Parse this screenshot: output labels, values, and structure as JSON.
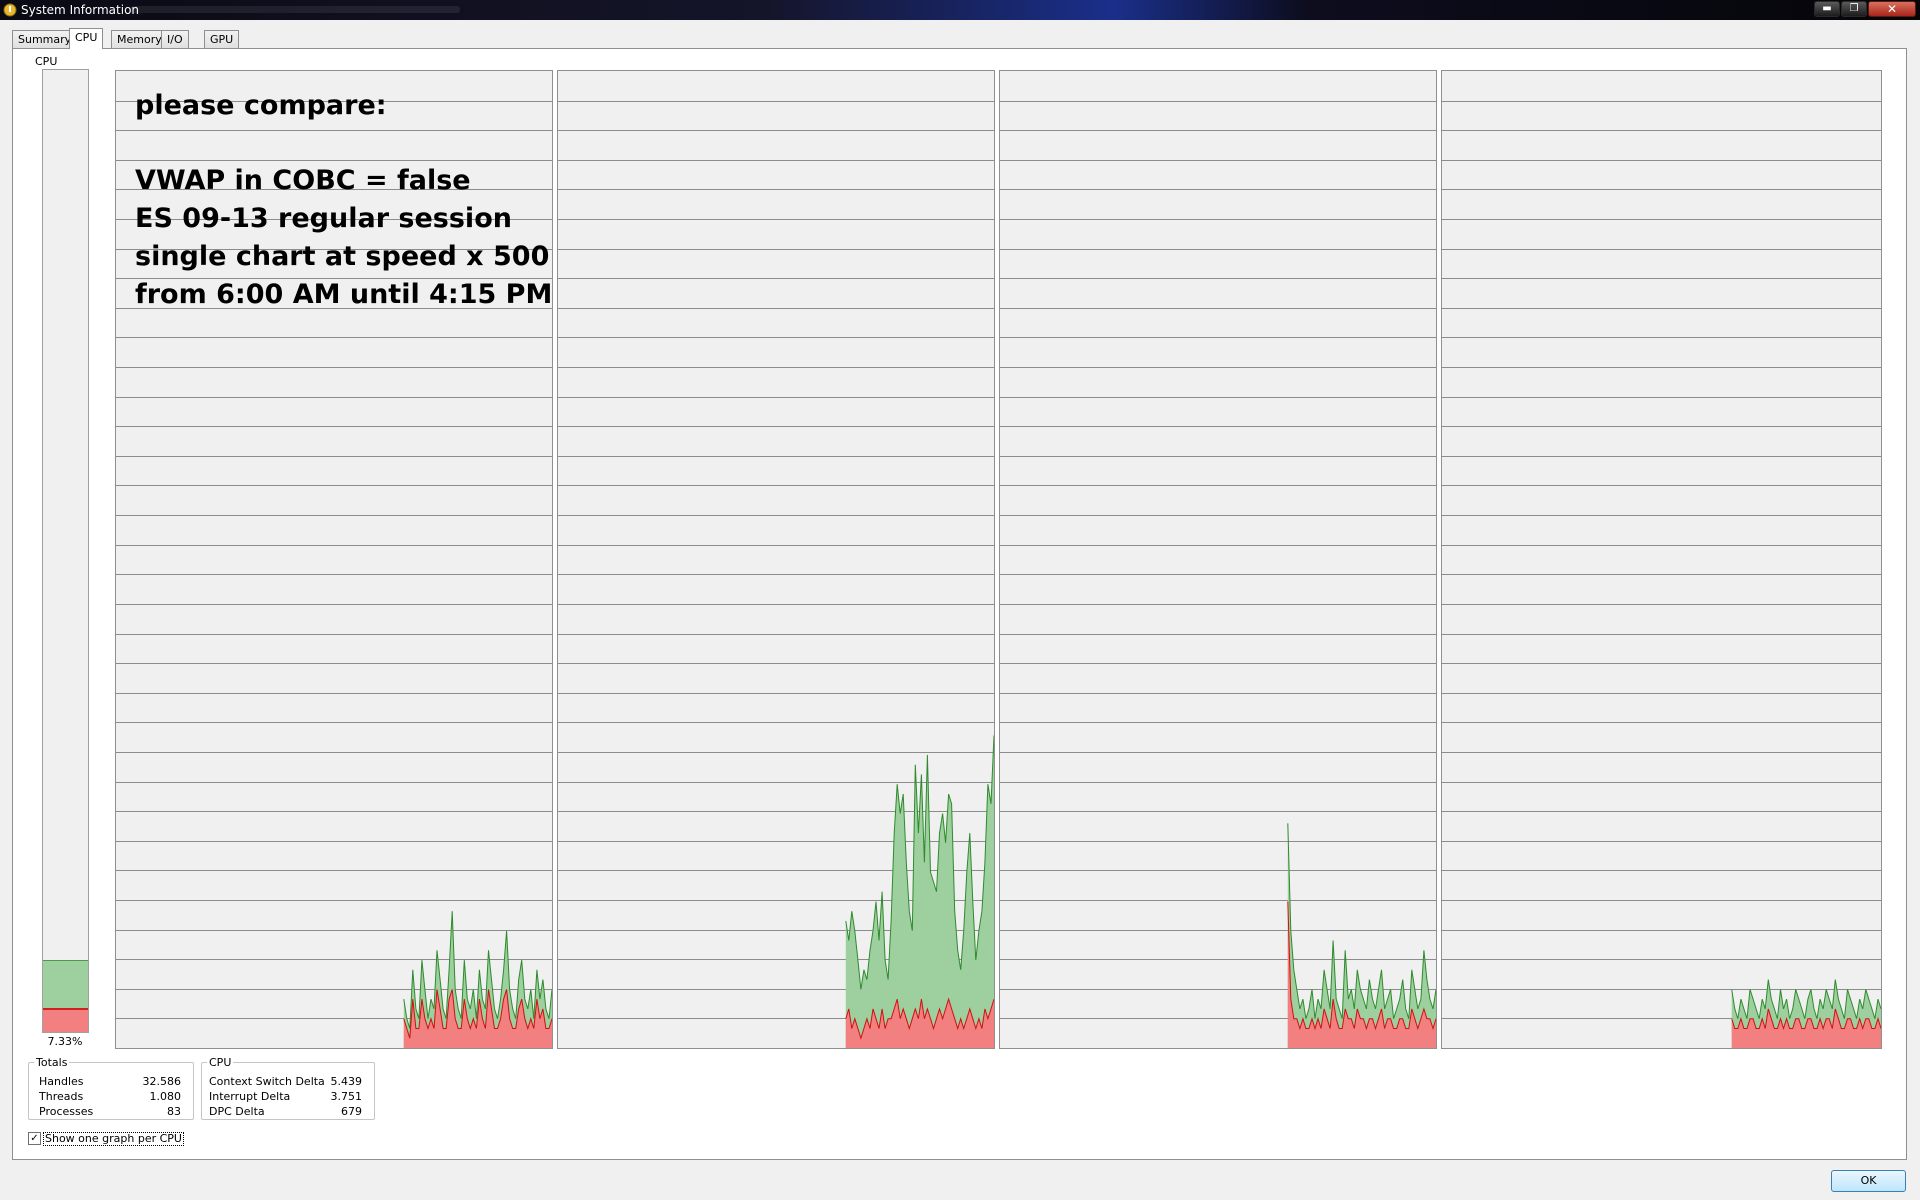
{
  "window": {
    "title": "System Information",
    "min_glyph": "▬",
    "max_glyph": "❐",
    "close_glyph": "✕"
  },
  "tabs": [
    {
      "label": "Summary",
      "active": false
    },
    {
      "label": "CPU",
      "active": true
    },
    {
      "label": "Memory",
      "active": false
    },
    {
      "label": "I/O",
      "active": false
    },
    {
      "label": "GPU",
      "active": false
    }
  ],
  "cpu_overview": {
    "label": "CPU",
    "percent_text": "7.33%",
    "total_fraction": 0.075,
    "kernel_fraction": 0.025
  },
  "annotation": {
    "line1": "please compare:",
    "line2": "VWAP in COBC = false",
    "line3": "ES 09-13 regular session",
    "line4": "single chart at speed x 500",
    "line5": "from 6:00 AM until 4:15 PM"
  },
  "totals": {
    "title": "Totals",
    "handles_label": "Handles",
    "handles_value": "32.586",
    "threads_label": "Threads",
    "threads_value": "1.080",
    "processes_label": "Processes",
    "processes_value": "83"
  },
  "cpu_stats": {
    "title": "CPU",
    "context_switch_label": "Context Switch Delta",
    "context_switch_value": "5.439",
    "interrupt_label": "Interrupt Delta",
    "interrupt_value": "3.751",
    "dpc_label": "DPC Delta",
    "dpc_value": "679"
  },
  "show_one_graph": {
    "label": "Show one graph per CPU",
    "checked": true,
    "check_glyph": "✓"
  },
  "ok_button": {
    "label": "OK"
  },
  "colors": {
    "total_line": "#2e8b2e",
    "total_fill": "#9ecf9e",
    "kernel_line": "#d01010",
    "kernel_fill": "#f28080",
    "grid": "#8c8c8c",
    "graph_bg": "#f0f0f0"
  },
  "chart_data": {
    "type": "area",
    "y_range": [
      0,
      100
    ],
    "series_per_cpu": [
      {
        "cpu": 1,
        "history_start": 0.66,
        "total_percent": [
          5,
          3,
          2,
          8,
          4,
          3,
          9,
          6,
          3,
          5,
          4,
          10,
          7,
          4,
          3,
          8,
          14,
          6,
          4,
          3,
          9,
          5,
          4,
          6,
          3,
          8,
          5,
          4,
          10,
          7,
          4,
          3,
          5,
          8,
          12,
          6,
          4,
          3,
          7,
          9,
          5,
          4,
          6,
          3,
          8,
          5,
          7,
          4,
          3,
          6
        ],
        "kernel_percent": [
          3,
          2,
          1,
          5,
          2,
          2,
          5,
          3,
          2,
          3,
          2,
          6,
          4,
          2,
          2,
          5,
          6,
          3,
          2,
          2,
          5,
          3,
          2,
          3,
          2,
          5,
          3,
          2,
          6,
          4,
          2,
          2,
          3,
          5,
          6,
          3,
          2,
          2,
          4,
          5,
          3,
          2,
          3,
          2,
          5,
          3,
          4,
          2,
          2,
          3
        ]
      },
      {
        "cpu": 2,
        "history_start": 0.66,
        "total_percent": [
          13,
          11,
          14,
          12,
          9,
          6,
          8,
          7,
          10,
          12,
          15,
          11,
          16,
          9,
          7,
          13,
          22,
          27,
          24,
          26,
          19,
          14,
          12,
          29,
          22,
          28,
          19,
          30,
          18,
          17,
          16,
          22,
          24,
          21,
          26,
          25,
          14,
          10,
          8,
          12,
          18,
          22,
          15,
          9,
          12,
          14,
          19,
          27,
          25,
          32
        ],
        "kernel_percent": [
          3,
          4,
          2,
          3,
          2,
          1,
          2,
          3,
          2,
          4,
          3,
          2,
          4,
          2,
          3,
          3,
          4,
          5,
          3,
          4,
          3,
          2,
          3,
          4,
          3,
          5,
          3,
          4,
          3,
          2,
          3,
          4,
          3,
          4,
          5,
          4,
          3,
          2,
          3,
          2,
          3,
          4,
          3,
          2,
          3,
          2,
          4,
          3,
          4,
          5
        ]
      },
      {
        "cpu": 3,
        "history_start": 0.66,
        "total_percent": [
          23,
          12,
          8,
          6,
          4,
          5,
          3,
          4,
          6,
          3,
          5,
          4,
          8,
          6,
          4,
          11,
          5,
          4,
          3,
          10,
          5,
          6,
          4,
          8,
          6,
          5,
          4,
          7,
          5,
          4,
          6,
          8,
          4,
          5,
          6,
          3,
          4,
          5,
          7,
          4,
          3,
          8,
          6,
          4,
          5,
          10,
          7,
          5,
          4,
          6
        ],
        "kernel_percent": [
          15,
          5,
          3,
          3,
          2,
          3,
          2,
          2,
          3,
          2,
          3,
          2,
          4,
          3,
          2,
          5,
          3,
          2,
          2,
          4,
          3,
          3,
          2,
          4,
          3,
          3,
          2,
          3,
          3,
          2,
          3,
          4,
          2,
          3,
          3,
          2,
          2,
          3,
          3,
          2,
          2,
          4,
          3,
          2,
          3,
          4,
          3,
          3,
          2,
          3
        ]
      },
      {
        "cpu": 4,
        "history_start": 0.66,
        "total_percent": [
          6,
          4,
          3,
          5,
          4,
          3,
          6,
          5,
          4,
          3,
          5,
          4,
          7,
          5,
          4,
          3,
          6,
          4,
          5,
          3,
          4,
          6,
          5,
          4,
          3,
          5,
          6,
          4,
          3,
          5,
          4,
          6,
          5,
          4,
          7,
          5,
          4,
          3,
          6,
          5,
          4,
          3,
          5,
          4,
          6,
          5,
          4,
          3,
          5,
          4
        ],
        "kernel_percent": [
          3,
          2,
          2,
          3,
          2,
          2,
          3,
          3,
          2,
          2,
          3,
          2,
          4,
          3,
          2,
          2,
          3,
          2,
          3,
          2,
          2,
          3,
          3,
          2,
          2,
          3,
          3,
          2,
          2,
          3,
          2,
          3,
          3,
          2,
          4,
          3,
          2,
          2,
          3,
          3,
          2,
          2,
          3,
          2,
          3,
          3,
          2,
          2,
          3,
          2
        ]
      }
    ]
  }
}
